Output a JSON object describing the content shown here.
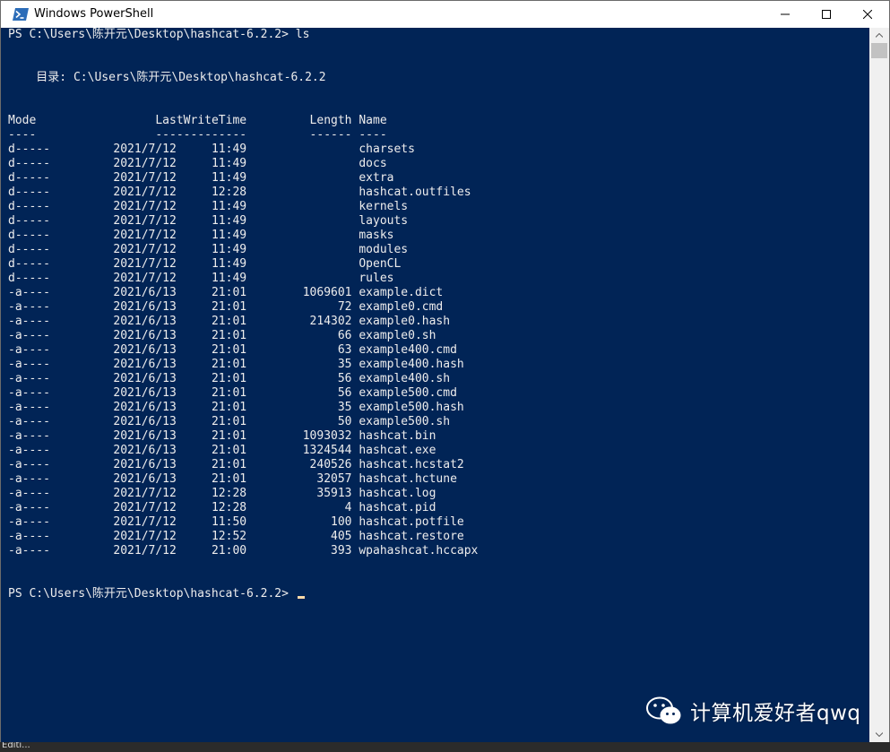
{
  "window": {
    "title": "Windows PowerShell",
    "controls": {
      "minimize": "minimize",
      "maximize": "maximize",
      "close": "close"
    }
  },
  "console": {
    "lines": [
      "PS C:\\Users\\陈开元\\Desktop\\hashcat-6.2.2> ls",
      "",
      "",
      "    目录: C:\\Users\\陈开元\\Desktop\\hashcat-6.2.2",
      "",
      "",
      "Mode                 LastWriteTime         Length Name",
      "----                 -------------         ------ ----",
      "d-----         2021/7/12     11:49                charsets",
      "d-----         2021/7/12     11:49                docs",
      "d-----         2021/7/12     11:49                extra",
      "d-----         2021/7/12     12:28                hashcat.outfiles",
      "d-----         2021/7/12     11:49                kernels",
      "d-----         2021/7/12     11:49                layouts",
      "d-----         2021/7/12     11:49                masks",
      "d-----         2021/7/12     11:49                modules",
      "d-----         2021/7/12     11:49                OpenCL",
      "d-----         2021/7/12     11:49                rules",
      "-a----         2021/6/13     21:01        1069601 example.dict",
      "-a----         2021/6/13     21:01             72 example0.cmd",
      "-a----         2021/6/13     21:01         214302 example0.hash",
      "-a----         2021/6/13     21:01             66 example0.sh",
      "-a----         2021/6/13     21:01             63 example400.cmd",
      "-a----         2021/6/13     21:01             35 example400.hash",
      "-a----         2021/6/13     21:01             56 example400.sh",
      "-a----         2021/6/13     21:01             56 example500.cmd",
      "-a----         2021/6/13     21:01             35 example500.hash",
      "-a----         2021/6/13     21:01             50 example500.sh",
      "-a----         2021/6/13     21:01        1093032 hashcat.bin",
      "-a----         2021/6/13     21:01        1324544 hashcat.exe",
      "-a----         2021/6/13     21:01         240526 hashcat.hcstat2",
      "-a----         2021/6/13     21:01          32057 hashcat.hctune",
      "-a----         2021/7/12     12:28          35913 hashcat.log",
      "-a----         2021/7/12     12:28              4 hashcat.pid",
      "-a----         2021/7/12     11:50            100 hashcat.potfile",
      "-a----         2021/7/12     12:52            405 hashcat.restore",
      "-a----         2021/7/12     21:00            393 wpahashcat.hccapx",
      "",
      "",
      "PS C:\\Users\\陈开元\\Desktop\\hashcat-6.2.2> "
    ]
  },
  "colors": {
    "console_background": "#012456",
    "console_text": "#eeeded",
    "cursor": "#fedba9"
  },
  "watermark": {
    "text": "计算机爱好者qwq",
    "icon": "wechat-icon"
  },
  "taskbar": {
    "fragment": "Editi..."
  }
}
